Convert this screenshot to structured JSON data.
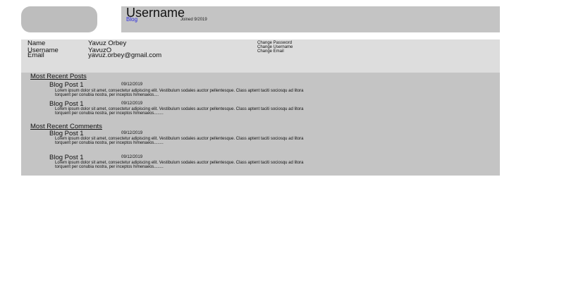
{
  "profile": {
    "username": "Username",
    "blog_link": "Blog",
    "joined": "Joined 9/2019"
  },
  "info": {
    "rows": [
      {
        "label": "Name",
        "value": "Yavuz Orbey"
      },
      {
        "label": "Username",
        "value": "YavuzO"
      },
      {
        "label": "Email",
        "value": "yavuz.orbey@gmail.com"
      }
    ],
    "actions": [
      "Change Password",
      "Change Username",
      "Change Email"
    ]
  },
  "posts": {
    "heading": "Most Recent Posts",
    "items": [
      {
        "title": "Blog Post 1",
        "date": "09/12/2019",
        "body": "Lorem ipsum dolor sit amet, consectetur adipiscing elit. Vestibulum sodales auctor pellentesque. Class aptent taciti sociosqu ad litora torquent per conubia nostra, per inceptos himenaeos...."
      },
      {
        "title": "Blog Post 1",
        "date": "09/12/2019",
        "body": "Lorem ipsum dolor sit amet, consectetur adipiscing elit. Vestibulum sodales auctor pellentesque. Class aptent taciti sociosqu ad litora torquent per conubia nostra, per inceptos himenaeos........"
      }
    ]
  },
  "comments": {
    "heading": "Most Recent Comments",
    "items": [
      {
        "title": "Blog Post 1",
        "date": "09/12/2019",
        "body": "Lorem ipsum dolor sit amet, consectetur adipiscing elit. Vestibulum sodales auctor pellentesque. Class aptent taciti sociosqu ad litora torquent per conubia nostra, per inceptos himenaeos........"
      },
      {
        "title": "Blog Post 1",
        "date": "09/12/2019",
        "body": "Lorem ipsum dolor sit amet, consectetur adipiscing elit. Vestibulum sodales auctor pellentesque. Class aptent taciti sociosqu ad litora torquent per conubia nostra, per inceptos himenaeos........"
      }
    ]
  }
}
